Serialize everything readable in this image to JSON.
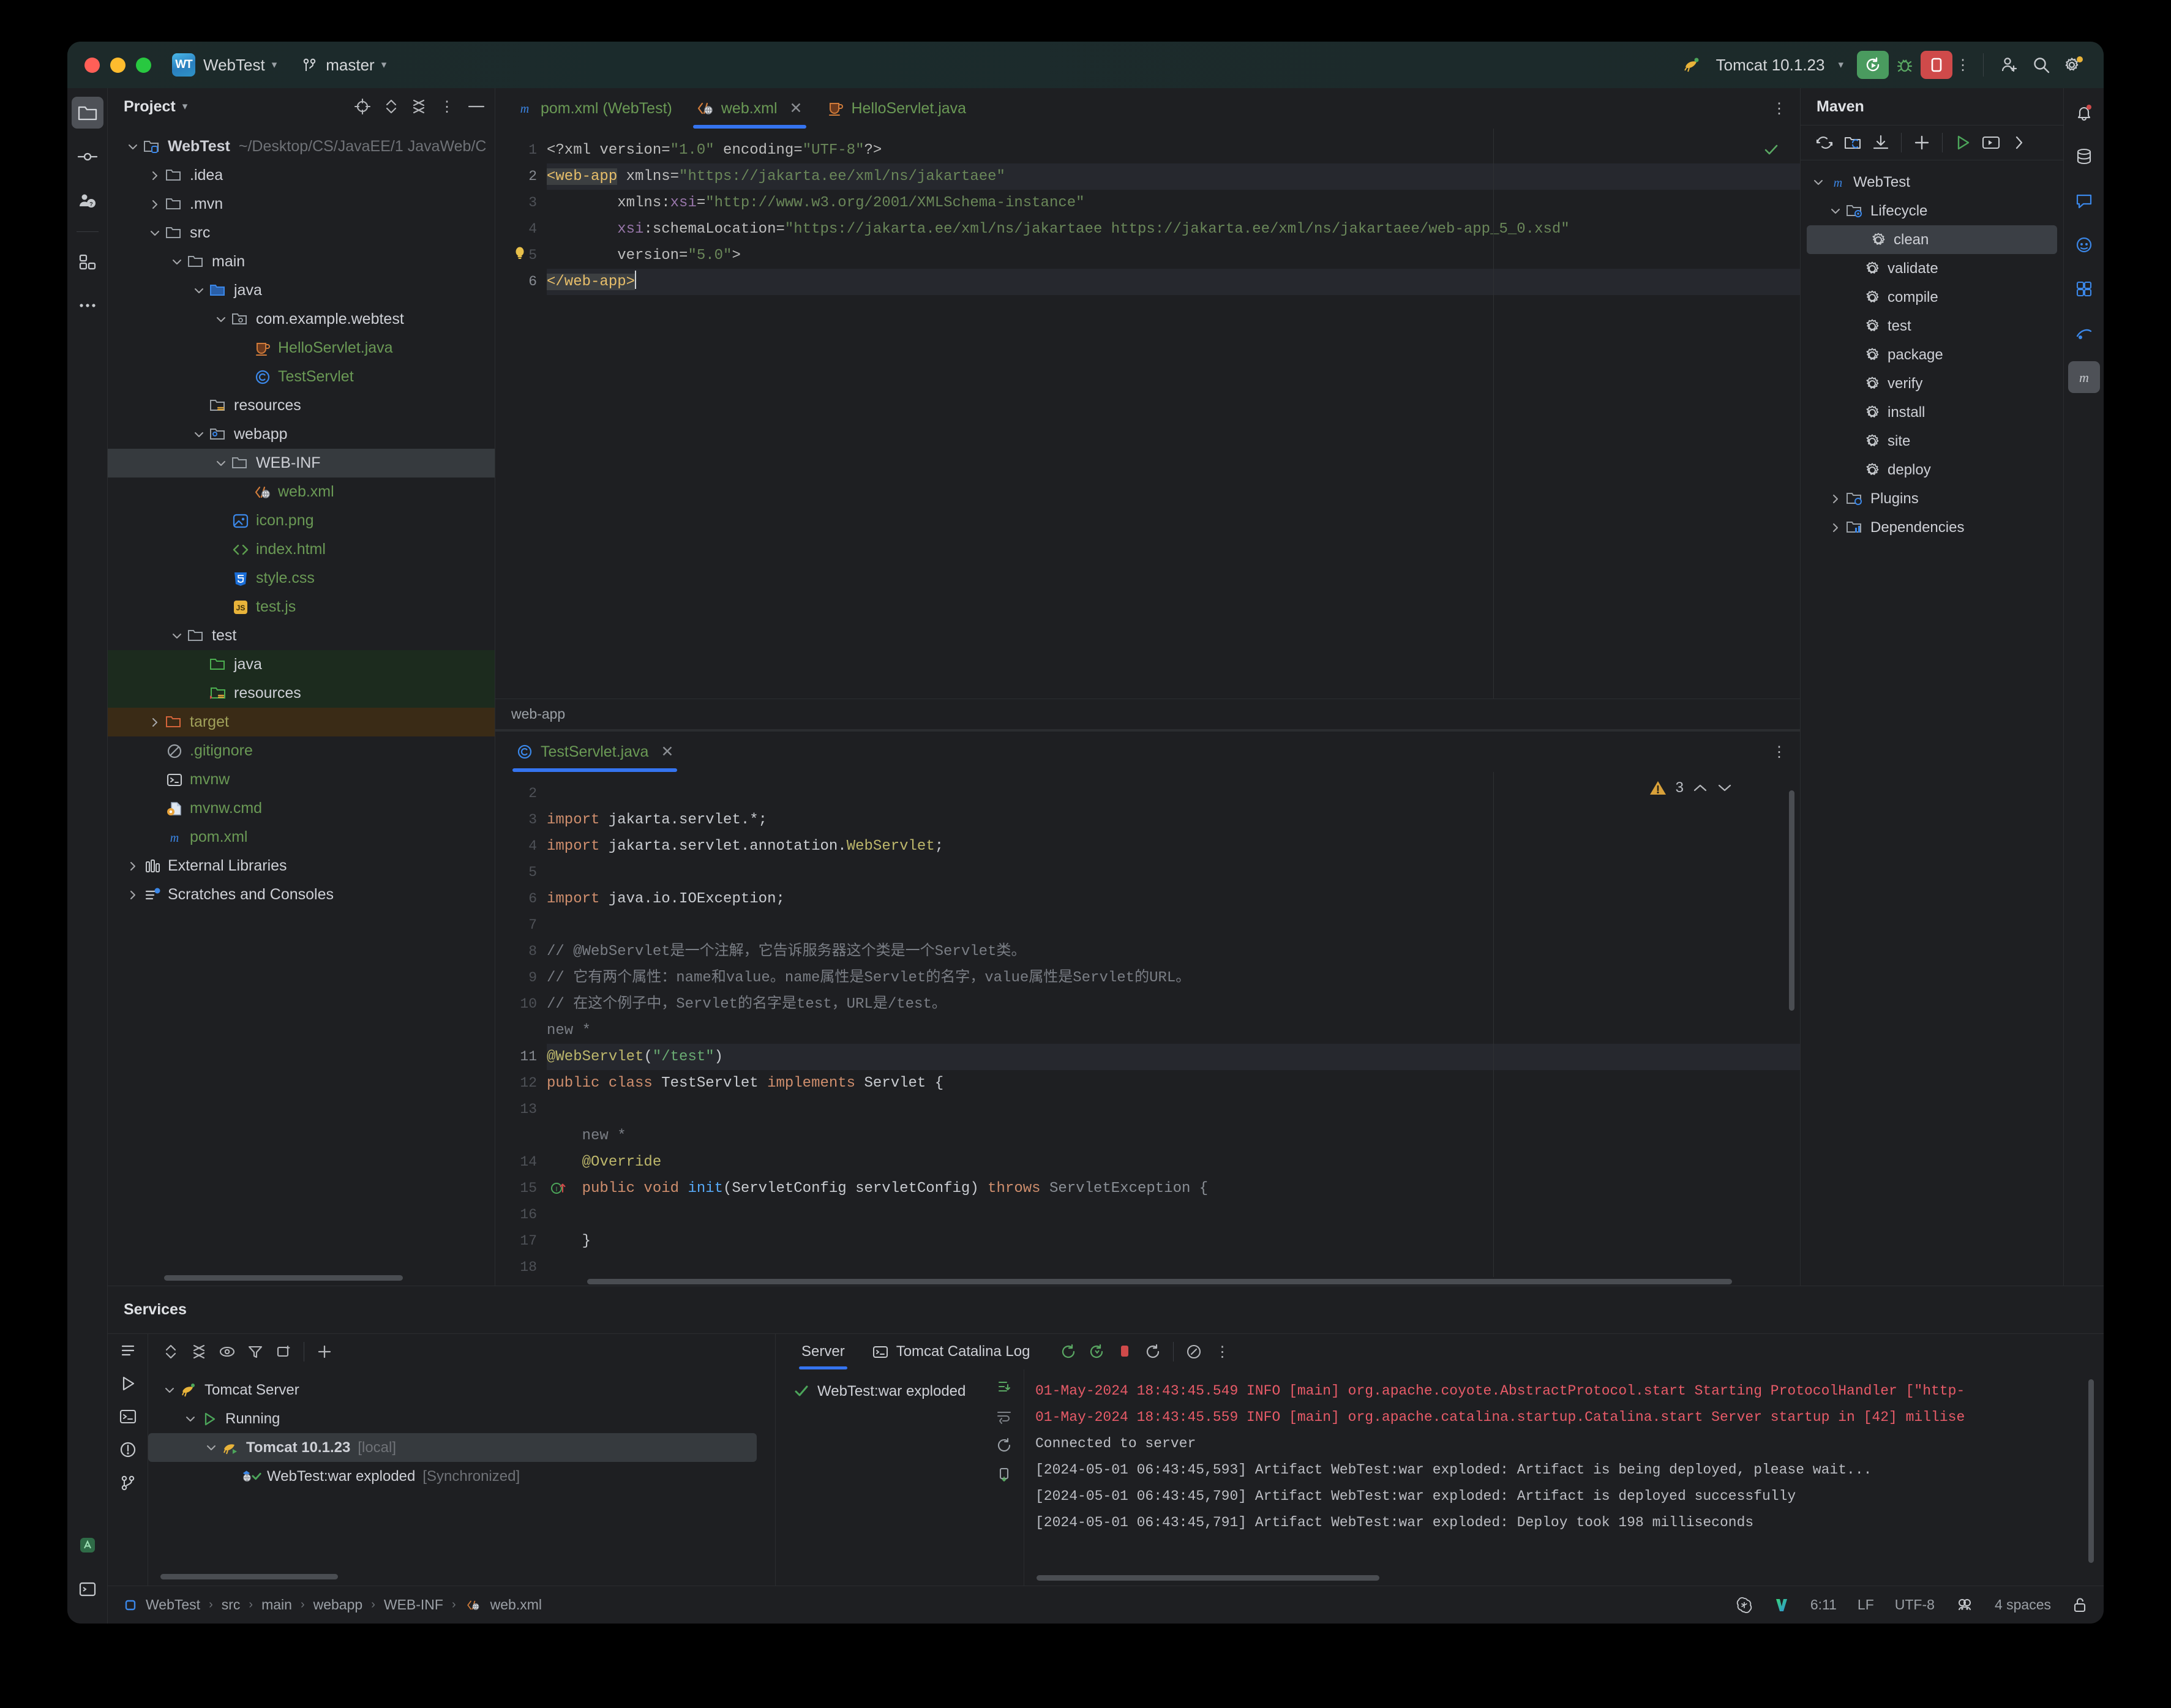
{
  "window": {
    "project_badge": "WT",
    "project_name": "WebTest",
    "branch": "master"
  },
  "toolbar": {
    "run_config": "Tomcat 10.1.23",
    "run_icon": "rerun-icon",
    "debug_icon": "debug-icon",
    "stop_icon": "stop-icon",
    "more_icon": "more-vertical-icon",
    "add_user_icon": "add-user-icon",
    "search_icon": "search-icon",
    "settings_icon": "gear-icon"
  },
  "rail": {
    "items": [
      {
        "name": "project-icon",
        "label": "Project"
      },
      {
        "name": "commit-icon",
        "label": "Commit"
      },
      {
        "name": "pull-requests-icon",
        "label": "Pull Requests"
      },
      {
        "name": "structure-icon",
        "label": "Structure"
      },
      {
        "name": "more-tools-icon",
        "label": "More"
      }
    ]
  },
  "project_tool_window": {
    "title": "Project",
    "actions": [
      "locate-icon",
      "expand-collapse-icon",
      "collapse-all-icon",
      "options-icon",
      "hide-icon"
    ],
    "tree": [
      {
        "label": "WebTest",
        "sub": "~/Desktop/CS/JavaEE/1 JavaWeb/C",
        "indent": 0,
        "arrow": "down",
        "icon": "module-folder-icon",
        "style": "bold"
      },
      {
        "label": ".idea",
        "indent": 1,
        "arrow": "right",
        "icon": "folder-icon",
        "style": "plain"
      },
      {
        "label": ".mvn",
        "indent": 1,
        "arrow": "right",
        "icon": "folder-icon",
        "style": "plain"
      },
      {
        "label": "src",
        "indent": 1,
        "arrow": "down",
        "icon": "folder-icon",
        "style": "plain"
      },
      {
        "label": "main",
        "indent": 2,
        "arrow": "down",
        "icon": "folder-icon",
        "style": "plain"
      },
      {
        "label": "java",
        "indent": 3,
        "arrow": "down",
        "icon": "source-root-icon",
        "style": "plain"
      },
      {
        "label": "com.example.webtest",
        "indent": 4,
        "arrow": "down",
        "icon": "package-icon",
        "style": "plain"
      },
      {
        "label": "HelloServlet.java",
        "indent": 5,
        "arrow": "none",
        "icon": "java-cup-icon",
        "style": "green"
      },
      {
        "label": "TestServlet",
        "indent": 5,
        "arrow": "none",
        "icon": "class-icon",
        "style": "green"
      },
      {
        "label": "resources",
        "indent": 3,
        "arrow": "none",
        "icon": "resource-root-icon",
        "style": "plain"
      },
      {
        "label": "webapp",
        "indent": 3,
        "arrow": "down",
        "icon": "web-root-icon",
        "style": "plain"
      },
      {
        "label": "WEB-INF",
        "indent": 4,
        "arrow": "down",
        "icon": "folder-icon",
        "style": "plain",
        "row": "selected"
      },
      {
        "label": "web.xml",
        "indent": 5,
        "arrow": "none",
        "icon": "xml-web-icon",
        "style": "green"
      },
      {
        "label": "icon.png",
        "indent": 4,
        "arrow": "none",
        "icon": "image-icon",
        "style": "green"
      },
      {
        "label": "index.html",
        "indent": 4,
        "arrow": "none",
        "icon": "html-icon",
        "style": "green"
      },
      {
        "label": "style.css",
        "indent": 4,
        "arrow": "none",
        "icon": "css-icon",
        "style": "green"
      },
      {
        "label": "test.js",
        "indent": 4,
        "arrow": "none",
        "icon": "js-icon",
        "style": "green"
      },
      {
        "label": "test",
        "indent": 2,
        "arrow": "down",
        "icon": "folder-icon",
        "style": "plain"
      },
      {
        "label": "java",
        "indent": 3,
        "arrow": "none",
        "icon": "test-source-root-icon",
        "style": "plain",
        "row": "green"
      },
      {
        "label": "resources",
        "indent": 3,
        "arrow": "none",
        "icon": "test-resource-root-icon",
        "style": "plain",
        "row": "green"
      },
      {
        "label": "target",
        "indent": 1,
        "arrow": "right",
        "icon": "excluded-folder-icon",
        "style": "olive",
        "row": "brown"
      },
      {
        "label": ".gitignore",
        "indent": 1,
        "arrow": "none",
        "icon": "gitignore-icon",
        "style": "green"
      },
      {
        "label": "mvnw",
        "indent": 1,
        "arrow": "none",
        "icon": "shell-icon",
        "style": "green"
      },
      {
        "label": "mvnw.cmd",
        "indent": 1,
        "arrow": "none",
        "icon": "cmd-file-icon",
        "style": "green"
      },
      {
        "label": "pom.xml",
        "indent": 1,
        "arrow": "none",
        "icon": "maven-icon",
        "style": "green"
      },
      {
        "label": "External Libraries",
        "indent": 0,
        "arrow": "right",
        "icon": "libraries-icon",
        "style": "plain"
      },
      {
        "label": "Scratches and Consoles",
        "indent": 0,
        "arrow": "right",
        "icon": "scratches-icon",
        "style": "plain"
      }
    ]
  },
  "editor_top": {
    "tabs": [
      {
        "label": "pom.xml (WebTest)",
        "icon": "maven-icon",
        "active": false,
        "closable": false
      },
      {
        "label": "web.xml",
        "icon": "xml-web-icon",
        "active": true,
        "closable": true
      },
      {
        "label": "HelloServlet.java",
        "icon": "java-cup-icon",
        "active": false,
        "closable": false
      }
    ],
    "kebab": "editor-options-icon",
    "inspection_status": "ok-check",
    "breadcrumb": "web-app",
    "lines": [
      {
        "n": "1",
        "segments": [
          {
            "t": "<?xml ",
            "c": "k-pi"
          },
          {
            "t": "version=",
            "c": "k-attr2"
          },
          {
            "t": "\"1.0\"",
            "c": "k-str"
          },
          {
            "t": " encoding=",
            "c": "k-attr2"
          },
          {
            "t": "\"UTF-8\"",
            "c": "k-str"
          },
          {
            "t": "?>",
            "c": "k-pi"
          }
        ]
      },
      {
        "n": "2",
        "current": true,
        "segments": [
          {
            "t": "<web-app",
            "c": "hl-tag"
          },
          {
            "t": " xmlns=",
            "c": "k-attr2"
          },
          {
            "t": "\"https://jakarta.ee/xml/ns/jakartaee\"",
            "c": "k-str"
          }
        ]
      },
      {
        "n": "3",
        "segments": [
          {
            "t": "        xmlns:",
            "c": "k-attr2"
          },
          {
            "t": "xsi",
            "c": "k-attr"
          },
          {
            "t": "=",
            "c": "k-attr2"
          },
          {
            "t": "\"http://www.w3.org/2001/XMLSchema-instance\"",
            "c": "k-str"
          }
        ]
      },
      {
        "n": "4",
        "segments": [
          {
            "t": "        ",
            "c": "k-attr2"
          },
          {
            "t": "xsi",
            "c": "k-attr"
          },
          {
            "t": ":schemaLocation=",
            "c": "k-attr2"
          },
          {
            "t": "\"https://jakarta.ee/xml/ns/jakartaee https://jakarta.ee/xml/ns/jakartaee/web-app_5_0.xsd\"",
            "c": "k-str"
          }
        ]
      },
      {
        "n": "5",
        "lamp": true,
        "segments": [
          {
            "t": "        version=",
            "c": "k-attr2"
          },
          {
            "t": "\"5.0\"",
            "c": "k-str"
          },
          {
            "t": ">",
            "c": "k-punct"
          }
        ]
      },
      {
        "n": "6",
        "current": true,
        "segments": [
          {
            "t": "</web-app>",
            "c": "hl-tag"
          }
        ]
      }
    ]
  },
  "editor_bottom": {
    "tabs": [
      {
        "label": "TestServlet.java",
        "icon": "class-icon",
        "active": true,
        "closable": true
      }
    ],
    "kebab": "editor-options-icon",
    "warning_count": "3",
    "warning_icon": "warning-triangle-icon",
    "nav_up_icon": "chevron-up-icon",
    "nav_down_icon": "chevron-down-icon",
    "lines": [
      {
        "n": "2",
        "segments": []
      },
      {
        "n": "3",
        "segments": [
          {
            "t": "import ",
            "c": "k-kw"
          },
          {
            "t": "jakarta.servlet.*;",
            "c": "k-ident"
          }
        ]
      },
      {
        "n": "4",
        "segments": [
          {
            "t": "import ",
            "c": "k-kw"
          },
          {
            "t": "jakarta.servlet.annotation.",
            "c": "k-ident"
          },
          {
            "t": "WebServlet",
            "c": "k-anno"
          },
          {
            "t": ";",
            "c": "k-ident"
          }
        ]
      },
      {
        "n": "5",
        "segments": []
      },
      {
        "n": "6",
        "segments": [
          {
            "t": "import ",
            "c": "k-kw"
          },
          {
            "t": "java.io.IOException;",
            "c": "k-ident"
          }
        ]
      },
      {
        "n": "7",
        "segments": []
      },
      {
        "n": "8",
        "segments": [
          {
            "t": "// @WebServlet是一个注解，它告诉服务器这个类是一个Servlet类。",
            "c": "k-com"
          }
        ]
      },
      {
        "n": "9",
        "segments": [
          {
            "t": "// 它有两个属性：name和value。name属性是Servlet的名字，value属性是Servlet的URL。",
            "c": "k-com"
          }
        ]
      },
      {
        "n": "10",
        "segments": [
          {
            "t": "// 在这个例子中，Servlet的名字是test，URL是/test。",
            "c": "k-com"
          }
        ]
      },
      {
        "n": "",
        "hint": "new *"
      },
      {
        "n": "11",
        "current": true,
        "segments": [
          {
            "t": "@WebServlet",
            "c": "k-anno"
          },
          {
            "t": "(",
            "c": "k-ident"
          },
          {
            "t": "\"/test\"",
            "c": "k-strj"
          },
          {
            "t": ")",
            "c": "k-ident"
          }
        ]
      },
      {
        "n": "12",
        "segments": [
          {
            "t": "public class ",
            "c": "k-kw"
          },
          {
            "t": "TestServlet ",
            "c": "k-ident"
          },
          {
            "t": "implements ",
            "c": "k-kw"
          },
          {
            "t": "Servlet {",
            "c": "k-ident"
          }
        ]
      },
      {
        "n": "13",
        "segments": []
      },
      {
        "n": "",
        "hint": "    new *"
      },
      {
        "n": "14",
        "segments": [
          {
            "t": "    @Override",
            "c": "k-anno"
          }
        ]
      },
      {
        "n": "15",
        "gutter_icon": "override-method-icon",
        "segments": [
          {
            "t": "    public void ",
            "c": "k-kw"
          },
          {
            "t": "init",
            "c": "k-fn"
          },
          {
            "t": "(ServletConfig servletConfig) ",
            "c": "k-ident"
          },
          {
            "t": "throws ",
            "c": "k-kw"
          },
          {
            "t": "ServletException {",
            "c": "k-type"
          }
        ]
      },
      {
        "n": "16",
        "segments": []
      },
      {
        "n": "17",
        "segments": [
          {
            "t": "    }",
            "c": "k-ident"
          }
        ]
      },
      {
        "n": "18",
        "segments": []
      }
    ]
  },
  "maven": {
    "title": "Maven",
    "toolbar_icons": [
      "reload-all-icon",
      "add-maven-project-icon",
      "download-sources-icon",
      "add-icon",
      "run-icon",
      "execute-goal-icon",
      "more-chevron-icon"
    ],
    "tree": [
      {
        "label": "WebTest",
        "indent": 0,
        "arrow": "down",
        "icon": "maven-icon"
      },
      {
        "label": "Lifecycle",
        "indent": 1,
        "arrow": "down",
        "icon": "lifecycle-folder-icon"
      },
      {
        "label": "clean",
        "indent": 2,
        "arrow": "none",
        "icon": "goal-icon",
        "selected": true
      },
      {
        "label": "validate",
        "indent": 2,
        "arrow": "none",
        "icon": "goal-icon"
      },
      {
        "label": "compile",
        "indent": 2,
        "arrow": "none",
        "icon": "goal-icon"
      },
      {
        "label": "test",
        "indent": 2,
        "arrow": "none",
        "icon": "goal-icon"
      },
      {
        "label": "package",
        "indent": 2,
        "arrow": "none",
        "icon": "goal-icon"
      },
      {
        "label": "verify",
        "indent": 2,
        "arrow": "none",
        "icon": "goal-icon"
      },
      {
        "label": "install",
        "indent": 2,
        "arrow": "none",
        "icon": "goal-icon"
      },
      {
        "label": "site",
        "indent": 2,
        "arrow": "none",
        "icon": "goal-icon"
      },
      {
        "label": "deploy",
        "indent": 2,
        "arrow": "none",
        "icon": "goal-icon"
      },
      {
        "label": "Plugins",
        "indent": 1,
        "arrow": "right",
        "icon": "plugins-folder-icon"
      },
      {
        "label": "Dependencies",
        "indent": 1,
        "arrow": "right",
        "icon": "dependencies-folder-icon"
      }
    ]
  },
  "right_rail": {
    "items": [
      {
        "name": "notifications-icon"
      },
      {
        "name": "database-icon"
      },
      {
        "name": "ai-assistant-icon"
      },
      {
        "name": "copilot-icon"
      },
      {
        "name": "plugins-icon"
      },
      {
        "name": "gradle-icon"
      },
      {
        "name": "maven-sidebar-icon",
        "active": true
      }
    ]
  },
  "services": {
    "title": "Services",
    "left_toolbar_icons": [
      "expand-icon",
      "collapse-icon",
      "show-icon",
      "filter-icon",
      "group-icon",
      "add-service-icon"
    ],
    "tree": [
      {
        "label": "Tomcat Server",
        "indent": 0,
        "arrow": "down",
        "icon": "tomcat-icon"
      },
      {
        "label": "Running",
        "indent": 1,
        "arrow": "down",
        "icon": "running-icon"
      },
      {
        "label": "Tomcat 10.1.23",
        "sub": "[local]",
        "indent": 2,
        "arrow": "down",
        "icon": "tomcat-run-icon",
        "selected": true
      },
      {
        "label": "WebTest:war exploded",
        "sub": "[Synchronized]",
        "indent": 3,
        "arrow": "none",
        "icon": "artifact-ok-icon"
      }
    ],
    "console_tabs": [
      {
        "label": "Server",
        "active": true,
        "icon": null
      },
      {
        "label": "Tomcat Catalina Log",
        "active": false,
        "icon": "log-icon"
      }
    ],
    "console_toolbar_icons": [
      "rerun-icon",
      "rerun-debug-icon",
      "stop-icon",
      "restart-icon",
      "attach-icon",
      "more-vertical-icon"
    ],
    "deployment_items": [
      {
        "label": "WebTest:war exploded",
        "icon": "check-icon"
      }
    ],
    "console_rail_icons": [
      "scroll-to-end-icon",
      "soft-wrap-icon",
      "rerun-console-icon",
      "clear-all-icon"
    ],
    "console_lines": [
      {
        "text": "01-May-2024 18:43:45.549 INFO [main] org.apache.coyote.AbstractProtocol.start Starting ProtocolHandler [\"http-",
        "style": "err"
      },
      {
        "text": "01-May-2024 18:43:45.559 INFO [main] org.apache.catalina.startup.Catalina.start Server startup in [42] millise",
        "style": "err"
      },
      {
        "text": "Connected to server",
        "style": "normal"
      },
      {
        "text": "[2024-05-01 06:43:45,593] Artifact WebTest:war exploded: Artifact is being deployed, please wait...",
        "style": "normal"
      },
      {
        "text": "[2024-05-01 06:43:45,790] Artifact WebTest:war exploded: Artifact is deployed successfully",
        "style": "normal"
      },
      {
        "text": "[2024-05-01 06:43:45,791] Artifact WebTest:war exploded: Deploy took 198 milliseconds",
        "style": "normal"
      }
    ]
  },
  "statusbar": {
    "breadcrumb": [
      "WebTest",
      "src",
      "main",
      "webapp",
      "WEB-INF",
      "web.xml"
    ],
    "breadcrumb_icon": "module-small-icon",
    "file_icon": "xml-web-icon",
    "right": {
      "ai_icon": "openai-icon",
      "vendor_icon": "v-logo-icon",
      "caret": "6:11",
      "line_separator": "LF",
      "encoding": "UTF-8",
      "inspector_icon": "inspection-widget-icon",
      "indent": "4 spaces",
      "lock_icon": "unlocked-icon"
    }
  },
  "colors": {
    "accent": "#3574f0",
    "green_text": "#6a9955",
    "error_red": "#e85b68",
    "bg": "#1e1f22",
    "panel_sel": "#363a3e",
    "run_green": "#4a9b5f",
    "stop_red": "#cf4a4a"
  }
}
